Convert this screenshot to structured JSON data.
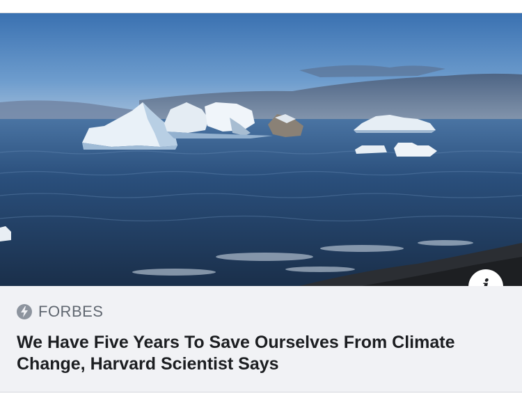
{
  "link_card": {
    "image": {
      "description_icon": "icebergs-photo"
    },
    "info_button": {
      "label": "i",
      "icon": "info-icon"
    },
    "source": {
      "icon": "lightning-bolt-icon",
      "name": "FORBES"
    },
    "headline": "We Have Five Years To Save Ourselves From Climate Change, Harvard Scientist Says"
  },
  "colors": {
    "caption_bg": "#f1f2f5",
    "headline_text": "#1c1e21",
    "source_text": "#606770",
    "sky": "#3f79b8",
    "sea": "#213f63"
  }
}
